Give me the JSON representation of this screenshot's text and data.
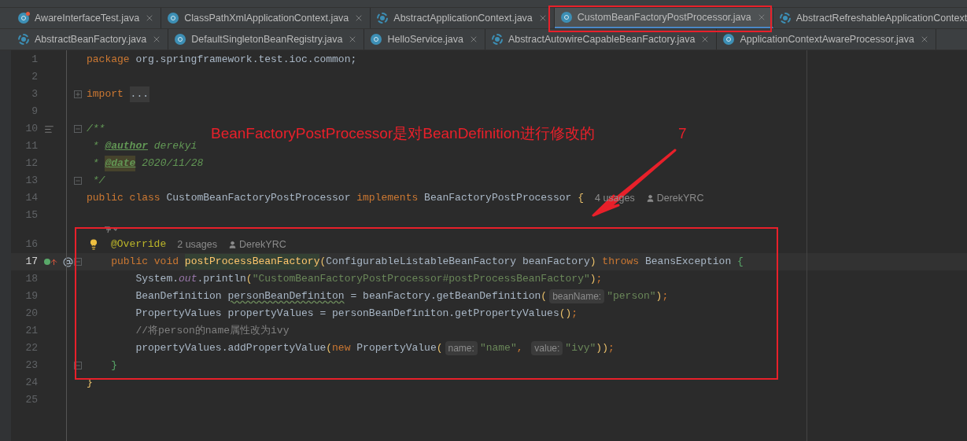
{
  "tab_rows": [
    [
      {
        "label": "AwareInterfaceTest.java",
        "kind": "class-run",
        "selected": false,
        "closable": true
      },
      {
        "label": "ClassPathXmlApplicationContext.java",
        "kind": "class",
        "selected": false,
        "closable": true
      },
      {
        "label": "AbstractApplicationContext.java",
        "kind": "abstract",
        "selected": false,
        "closable": true
      },
      {
        "label": "CustomBeanFactoryPostProcessor.java",
        "kind": "class",
        "selected": true,
        "closable": true
      },
      {
        "label": "AbstractRefreshableApplicationContext",
        "kind": "abstract",
        "selected": false,
        "closable": false
      }
    ],
    [
      {
        "label": "AbstractBeanFactory.java",
        "kind": "abstract",
        "selected": false,
        "closable": true
      },
      {
        "label": "DefaultSingletonBeanRegistry.java",
        "kind": "class",
        "selected": false,
        "closable": true
      },
      {
        "label": "HelloService.java",
        "kind": "class",
        "selected": false,
        "closable": true
      },
      {
        "label": "AbstractAutowireCapableBeanFactory.java",
        "kind": "abstract",
        "selected": false,
        "closable": true
      },
      {
        "label": "ApplicationContextAwareProcessor.java",
        "kind": "class",
        "selected": false,
        "closable": true
      }
    ]
  ],
  "lines": [
    {
      "number": "1",
      "current": false,
      "tokens": [
        {
          "kind": "keyword",
          "text": "package"
        },
        {
          "kind": "plain",
          "text": " org.springframework.test.ioc.common;"
        }
      ]
    },
    {
      "number": "2",
      "current": false
    },
    {
      "number": "3",
      "current": false,
      "marks": [
        {
          "kind": "fold-expand"
        }
      ],
      "tokens": [
        {
          "kind": "keyword",
          "text": "import "
        },
        {
          "kind": "folded",
          "text": "..."
        }
      ]
    },
    {
      "number": "9",
      "current": false
    },
    {
      "number": "10",
      "current": false,
      "marks": [
        {
          "kind": "doc"
        },
        {
          "kind": "fold-collapse"
        }
      ],
      "tokens": [
        {
          "kind": "doc",
          "text": "/**"
        }
      ]
    },
    {
      "number": "11",
      "current": false,
      "tokens": [
        {
          "kind": "doc",
          "text": " * "
        },
        {
          "kind": "doctag",
          "text": "@author"
        },
        {
          "kind": "docitalic",
          "text": " derekyi"
        }
      ]
    },
    {
      "number": "12",
      "current": false,
      "tokens": [
        {
          "kind": "doc",
          "text": " * "
        },
        {
          "kind": "doctag-marked",
          "text": "@date"
        },
        {
          "kind": "docitalic",
          "text": " 2020/11/28"
        }
      ]
    },
    {
      "number": "13",
      "current": false,
      "marks": [
        {
          "kind": "fold-collapse"
        }
      ],
      "tokens": [
        {
          "kind": "doc",
          "text": " */"
        }
      ]
    },
    {
      "number": "14",
      "current": false,
      "usages": "4 usages",
      "author": "DerekYRC",
      "tokens": [
        {
          "kind": "keyword",
          "text": "public class "
        },
        {
          "kind": "plain",
          "text": "CustomBeanFactoryPostProcessor "
        },
        {
          "kind": "keyword",
          "text": "implements "
        },
        {
          "kind": "plain",
          "text": "BeanFactoryPostProcessor "
        },
        {
          "kind": "paren",
          "text": "{"
        }
      ]
    },
    {
      "number": "15",
      "current": false
    },
    {
      "number": "16",
      "current": false,
      "bulb": true,
      "inlay_icon": true,
      "usages": "2 usages",
      "author": "DerekYRC",
      "tokens": [
        {
          "kind": "annotation",
          "text": "@Override"
        }
      ]
    },
    {
      "number": "17",
      "current": true,
      "marks": [
        {
          "kind": "implements"
        },
        {
          "kind": "autowired"
        },
        {
          "kind": "fold-collapse"
        }
      ],
      "tokens": [
        {
          "kind": "keyword",
          "text": "    public void "
        },
        {
          "kind": "method-marked",
          "text": "postProcessBeanFactory"
        },
        {
          "kind": "paren",
          "text": "("
        },
        {
          "kind": "plain",
          "text": "ConfigurableListableBeanFactory beanFactory"
        },
        {
          "kind": "paren",
          "text": ")"
        },
        {
          "kind": "keyword",
          "text": " throws "
        },
        {
          "kind": "plain",
          "text": "BeansException "
        },
        {
          "kind": "brace",
          "text": "{"
        }
      ]
    },
    {
      "number": "18",
      "current": false,
      "tokens": [
        {
          "kind": "plain",
          "text": "        System."
        },
        {
          "kind": "field",
          "text": "out"
        },
        {
          "kind": "plain",
          "text": ".println"
        },
        {
          "kind": "paren",
          "text": "("
        },
        {
          "kind": "string",
          "text": "\"CustomBeanFactoryPostProcessor#postProcessBeanFactory\""
        },
        {
          "kind": "paren",
          "text": ")"
        },
        {
          "kind": "keyword",
          "text": ";"
        }
      ]
    },
    {
      "number": "19",
      "current": false,
      "tokens": [
        {
          "kind": "plain",
          "text": "        BeanDefinition "
        },
        {
          "kind": "typo",
          "text": "personBeanDefiniton"
        },
        {
          "kind": "plain",
          "text": " = beanFactory.getBeanDefinition"
        },
        {
          "kind": "paren",
          "text": "("
        },
        {
          "kind": "hint",
          "text": "beanName:"
        },
        {
          "kind": "string",
          "text": "\"person\""
        },
        {
          "kind": "paren",
          "text": ")"
        },
        {
          "kind": "keyword",
          "text": ";"
        }
      ]
    },
    {
      "number": "20",
      "current": false,
      "tokens": [
        {
          "kind": "plain",
          "text": "        PropertyValues propertyValues = personBeanDefiniton.getPropertyValues"
        },
        {
          "kind": "paren",
          "text": "()"
        },
        {
          "kind": "keyword",
          "text": ";"
        }
      ]
    },
    {
      "number": "21",
      "current": false,
      "tokens": [
        {
          "kind": "comment",
          "text": "        //将person的name属性改为ivy"
        }
      ]
    },
    {
      "number": "22",
      "current": false,
      "tokens": [
        {
          "kind": "plain",
          "text": "        propertyValues.addPropertyValue"
        },
        {
          "kind": "paren",
          "text": "("
        },
        {
          "kind": "keyword",
          "text": "new "
        },
        {
          "kind": "plain",
          "text": "PropertyValue"
        },
        {
          "kind": "paren",
          "text": "("
        },
        {
          "kind": "hint",
          "text": "name:"
        },
        {
          "kind": "string",
          "text": "\"name\""
        },
        {
          "kind": "keyword",
          "text": ", "
        },
        {
          "kind": "hint",
          "text": "value:"
        },
        {
          "kind": "string",
          "text": "\"ivy\""
        },
        {
          "kind": "paren",
          "text": "))"
        },
        {
          "kind": "keyword",
          "text": ";"
        }
      ]
    },
    {
      "number": "23",
      "current": false,
      "marks": [
        {
          "kind": "fold-collapse"
        }
      ],
      "tokens": [
        {
          "kind": "brace",
          "text": "    }"
        }
      ]
    },
    {
      "number": "24",
      "current": false,
      "tokens": [
        {
          "kind": "paren",
          "text": "}"
        }
      ]
    },
    {
      "number": "25",
      "current": false
    }
  ],
  "annotation": {
    "note": "BeanFactoryPostProcessor是对BeanDefinition进行修改的",
    "number": "7"
  }
}
